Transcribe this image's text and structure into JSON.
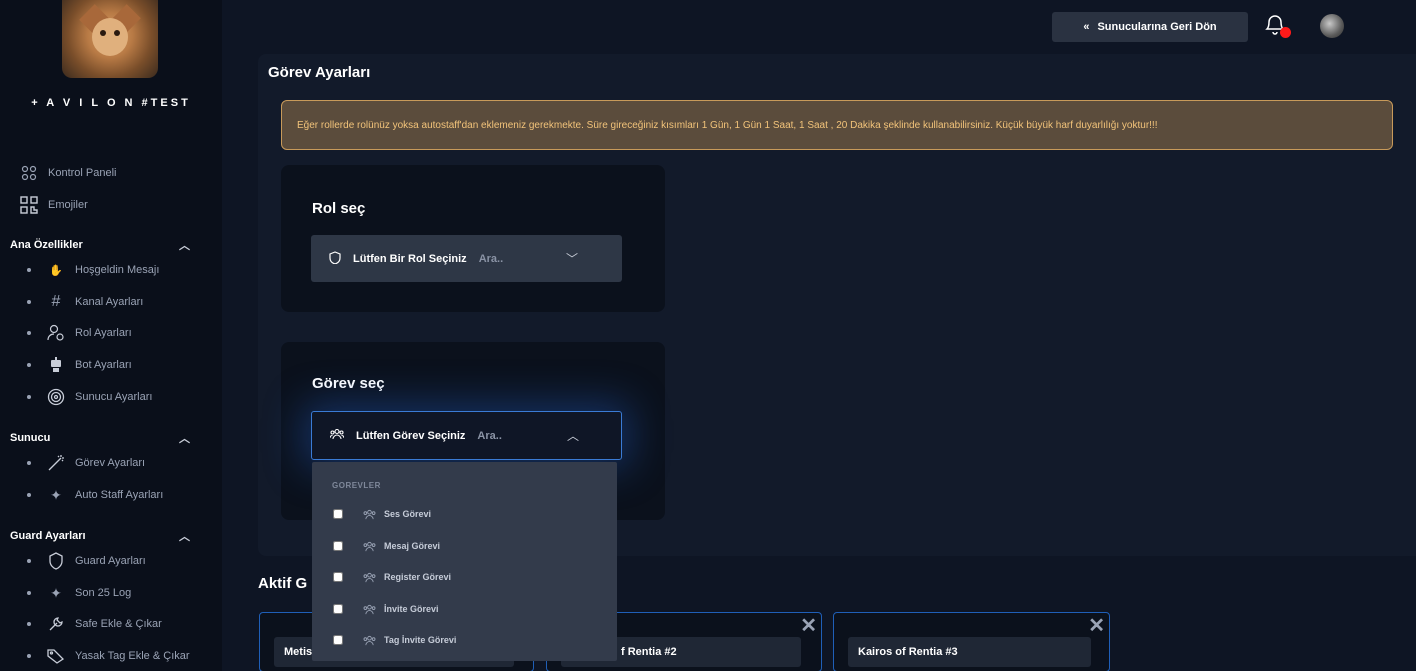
{
  "sidebar": {
    "brand": "+ A V I L O N #TEST",
    "top_items": [
      {
        "label": "Kontrol Paneli",
        "icon": "grid-icon"
      },
      {
        "label": "Emojiler",
        "icon": "emoji-icon"
      }
    ],
    "sections": [
      {
        "title": "Ana Özellikler",
        "items": [
          {
            "label": "Hoşgeldin Mesajı",
            "icon": "wave-hand-icon"
          },
          {
            "label": "Kanal Ayarları",
            "icon": "hash-icon"
          },
          {
            "label": "Rol Ayarları",
            "icon": "user-gear-icon"
          },
          {
            "label": "Bot Ayarları",
            "icon": "robot-icon"
          },
          {
            "label": "Sunucu Ayarları",
            "icon": "target-icon"
          }
        ]
      },
      {
        "title": "Sunucu",
        "items": [
          {
            "label": "Görev Ayarları",
            "icon": "magic-wand-icon"
          },
          {
            "label": "Auto Staff Ayarları",
            "icon": "sparkle-icon"
          }
        ]
      },
      {
        "title": "Guard Ayarları",
        "items": [
          {
            "label": "Guard Ayarları",
            "icon": "shield-icon"
          },
          {
            "label": "Son 25 Log",
            "icon": "sparkle-icon"
          },
          {
            "label": "Safe Ekle & Çıkar",
            "icon": "wrench-icon"
          },
          {
            "label": "Yasak Tag Ekle & Çıkar",
            "icon": "tag-icon"
          }
        ]
      }
    ]
  },
  "header": {
    "back_label": "Sunucularına Geri Dön"
  },
  "main": {
    "title": "Görev Ayarları",
    "alert": "Eğer rollerde rolünüz yoksa autostaff'dan eklemeniz gerekmekte. Süre gireceğiniz kısımları 1 Gün, 1 Gün 1 Saat, 1 Saat , 20 Dakika şeklinde kullanabilirsiniz. Küçük büyük harf duyarlılığı yoktur!!!",
    "role_card": {
      "title": "Rol seç",
      "select_label": "Lütfen Bir Rol Seçiniz",
      "placeholder": "Ara.."
    },
    "task_card": {
      "title": "Görev seç",
      "select_label": "Lütfen Görev Seçiniz",
      "placeholder": "Ara.."
    },
    "dropdown": {
      "header": "GOREVLER",
      "options": [
        "Ses Görevi",
        "Mesaj Görevi",
        "Register Görevi",
        "İnvite Görevi",
        "Tag İnvite Görevi"
      ]
    },
    "active_title": "Aktif G",
    "active_tasks": [
      "Metis",
      "f Rentia #2",
      "Kairos of Rentia #3"
    ]
  },
  "colors": {
    "accent": "#1f5fb8",
    "alert_bg": "#5b4c3c",
    "alert_text": "#f2c37a",
    "notification": "#ff1a1a"
  }
}
